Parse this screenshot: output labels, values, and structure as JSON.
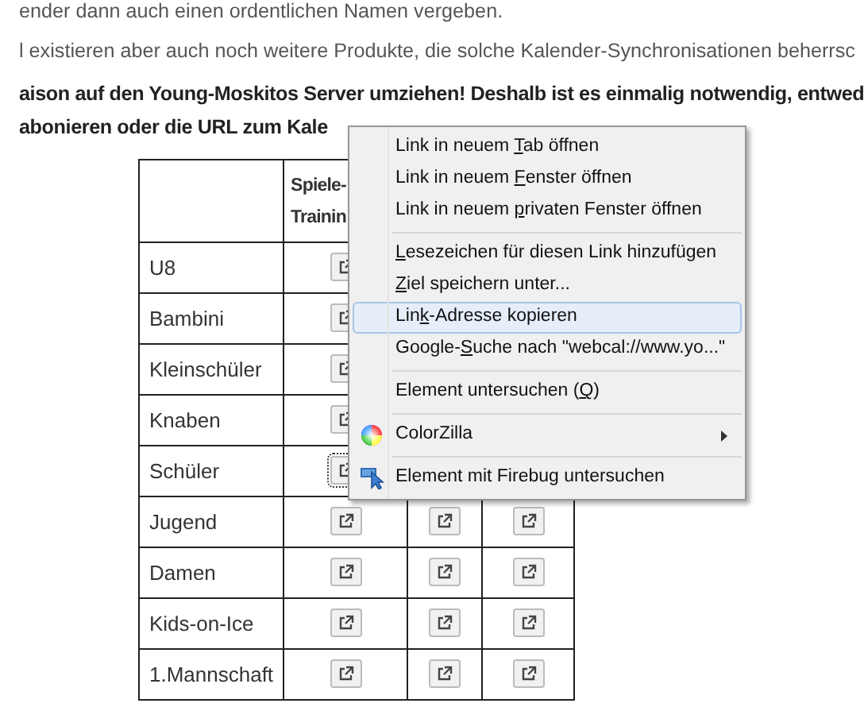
{
  "paragraphs": [
    {
      "text": "ender dann auch einen ordentlichen Namen vergeben.",
      "bold": false
    },
    {
      "text": "l existieren aber auch noch weitere Produkte, die solche Kalender-Synchronisationen beherrsc",
      "bold": false
    },
    {
      "text": "aison auf den Young-Moskitos Server umziehen! Deshalb ist es einmalig notwendig, entwed",
      "bold": true
    },
    {
      "text": "abonieren oder die URL zum Kale",
      "bold": true
    }
  ],
  "table": {
    "header": [
      "Spiele-",
      "Trainin"
    ],
    "rows": [
      {
        "label": "U8",
        "focused": false
      },
      {
        "label": "Bambini",
        "focused": false
      },
      {
        "label": "Kleinschüler",
        "focused": false
      },
      {
        "label": "Knaben",
        "focused": false
      },
      {
        "label": "Schüler",
        "focused": true
      },
      {
        "label": "Jugend",
        "focused": false
      },
      {
        "label": "Damen",
        "focused": false
      },
      {
        "label": "Kids-on-Ice",
        "focused": false
      },
      {
        "label": "1.Mannschaft",
        "focused": false
      }
    ]
  },
  "context_menu": [
    {
      "kind": "item",
      "parts": [
        {
          "text": "Link in neuem "
        },
        {
          "text": "T",
          "underlined": true
        },
        {
          "text": "ab öffnen"
        }
      ],
      "selected": false
    },
    {
      "kind": "item",
      "parts": [
        {
          "text": "Link in neuem "
        },
        {
          "text": "F",
          "underlined": true
        },
        {
          "text": "enster öffnen"
        }
      ],
      "selected": false
    },
    {
      "kind": "item",
      "parts": [
        {
          "text": "Link in neuem "
        },
        {
          "text": "p",
          "underlined": true
        },
        {
          "text": "rivaten Fenster öffnen"
        }
      ],
      "selected": false
    },
    {
      "kind": "separator"
    },
    {
      "kind": "item",
      "parts": [
        {
          "text": "L",
          "underlined": true
        },
        {
          "text": "esezeichen für diesen Link hinzufügen"
        }
      ],
      "selected": false
    },
    {
      "kind": "item",
      "parts": [
        {
          "text": "Z",
          "underlined": true
        },
        {
          "text": "iel speichern unter..."
        }
      ],
      "selected": false
    },
    {
      "kind": "item",
      "parts": [
        {
          "text": "Lin"
        },
        {
          "text": "k",
          "underlined": true
        },
        {
          "text": "-Adresse kopieren"
        }
      ],
      "selected": true
    },
    {
      "kind": "item",
      "parts": [
        {
          "text": "Google-"
        },
        {
          "text": "S",
          "underlined": true
        },
        {
          "text": "uche nach \"webcal://www.yo...\""
        }
      ],
      "selected": false
    },
    {
      "kind": "separator"
    },
    {
      "kind": "item",
      "parts": [
        {
          "text": "Element untersuchen ("
        },
        {
          "text": "Q",
          "underlined": true
        },
        {
          "text": ")"
        }
      ],
      "selected": false
    },
    {
      "kind": "separator"
    },
    {
      "kind": "color-wheel-item",
      "submenu": true,
      "parts": [
        {
          "text": "ColorZilla"
        }
      ],
      "selected": false
    },
    {
      "kind": "separator"
    },
    {
      "kind": "pointer-item",
      "parts": [
        {
          "text": "Element mit Firebug untersuchen"
        }
      ],
      "selected": false
    }
  ]
}
